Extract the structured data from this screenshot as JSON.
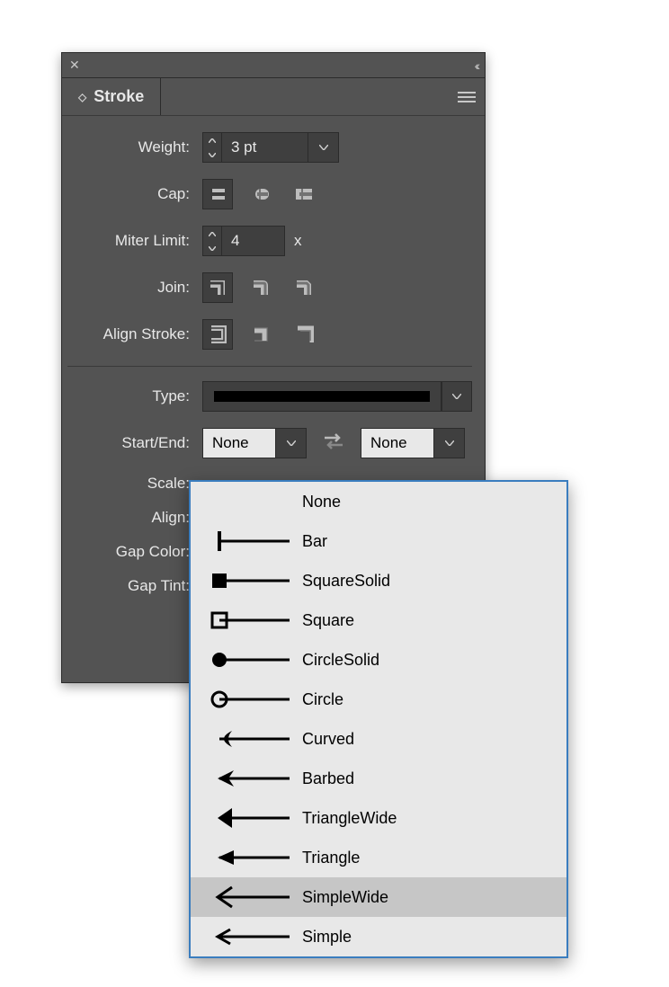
{
  "panel": {
    "title": "Stroke",
    "labels": {
      "weight": "Weight:",
      "cap": "Cap:",
      "miter": "Miter Limit:",
      "join": "Join:",
      "align_stroke": "Align Stroke:",
      "type": "Type:",
      "start_end": "Start/End:",
      "scale": "Scale:",
      "align": "Align:",
      "gap_color": "Gap Color:",
      "gap_tint": "Gap Tint:"
    },
    "weight_value": "3 pt",
    "miter_value": "4",
    "miter_suffix": "x",
    "start_value": "None",
    "end_value": "None"
  },
  "dropdown": {
    "items": [
      {
        "label": "None",
        "kind": "none"
      },
      {
        "label": "Bar",
        "kind": "bar"
      },
      {
        "label": "SquareSolid",
        "kind": "square_solid"
      },
      {
        "label": "Square",
        "kind": "square"
      },
      {
        "label": "CircleSolid",
        "kind": "circle_solid"
      },
      {
        "label": "Circle",
        "kind": "circle"
      },
      {
        "label": "Curved",
        "kind": "arrow_curved"
      },
      {
        "label": "Barbed",
        "kind": "arrow_barbed"
      },
      {
        "label": "TriangleWide",
        "kind": "arrow_triangle_wide"
      },
      {
        "label": "Triangle",
        "kind": "arrow_triangle"
      },
      {
        "label": "SimpleWide",
        "kind": "arrow_simple_wide",
        "hover": true
      },
      {
        "label": "Simple",
        "kind": "arrow_simple"
      }
    ]
  }
}
